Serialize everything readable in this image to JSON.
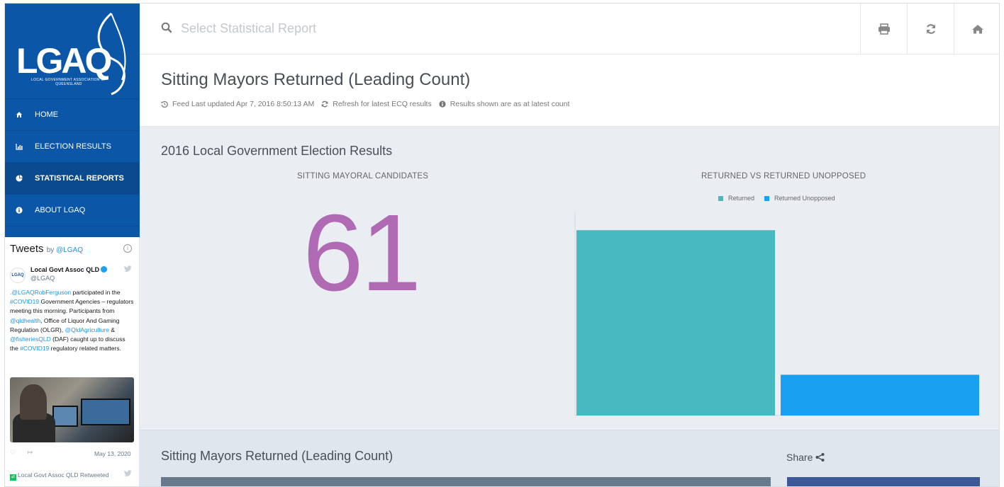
{
  "sidebar": {
    "logo": {
      "main": "LGAQ",
      "sub": "LOCAL GOVERNMENT ASSOCIATION OF QUEENSLAND"
    },
    "nav": [
      {
        "label": "HOME",
        "icon": "home-icon",
        "active": false
      },
      {
        "label": "ELECTION RESULTS",
        "icon": "bar-chart-icon",
        "active": false
      },
      {
        "label": "STATISTICAL REPORTS",
        "icon": "pie-chart-icon",
        "active": true
      },
      {
        "label": "ABOUT LGAQ",
        "icon": "info-icon",
        "active": false
      }
    ]
  },
  "tweets": {
    "heading": "Tweets",
    "by": "by",
    "handle_link": "@LGAQ",
    "tweet": {
      "avatar_text": "LGAQ",
      "name": "Local Govt Assoc QLD",
      "handle": "@LGAQ",
      "text_parts": [
        {
          "t": ".@LGAQRobFerguson",
          "link": true
        },
        {
          "t": " participated in the ",
          "link": false
        },
        {
          "t": "#COVID19",
          "link": true
        },
        {
          "t": " Government Agencies – regulators meeting this morning. Participants from ",
          "link": false
        },
        {
          "t": "@qldhealth",
          "link": true
        },
        {
          "t": ", Office of Liquor And Gaming Regulation (OLGR), ",
          "link": false
        },
        {
          "t": "@QldAgriculture",
          "link": true
        },
        {
          "t": " & ",
          "link": false
        },
        {
          "t": "@fisheriesQLD",
          "link": true
        },
        {
          "t": " (DAF) caught up to discuss the ",
          "link": false
        },
        {
          "t": "#COVID19",
          "link": true
        },
        {
          "t": " regulatory related matters.",
          "link": false
        }
      ],
      "date": "May 13, 2020"
    },
    "retweet_label": "Local Govt Assoc QLD Retweeted"
  },
  "topbar": {
    "search_placeholder": "Select Statistical Report"
  },
  "header": {
    "title": "Sitting Mayors Returned (Leading Count)",
    "meta": [
      {
        "icon": "history-icon",
        "text": "Feed Last updated Apr 7, 2016 8:50:13 AM"
      },
      {
        "icon": "refresh-small-icon",
        "text": "Refresh for latest ECQ results"
      },
      {
        "icon": "info-small-icon",
        "text": "Results shown are as at latest count"
      }
    ]
  },
  "section": {
    "title": "2016 Local Government Election Results",
    "left_label": "SITTING MAYORAL CANDIDATES",
    "big_number": "61",
    "right_label": "RETURNED VS RETURNED UNOPPOSED"
  },
  "colors": {
    "sidebar_bg": "#0b56a6",
    "big_number": "#b06ab3",
    "returned": "#48b9c0",
    "returned_unopposed": "#1aa0f0"
  },
  "chart_data": {
    "type": "bar",
    "categories": [
      "Returned",
      "Returned Unopposed"
    ],
    "series": [
      {
        "name": "Returned",
        "values": [
          50
        ]
      },
      {
        "name": "Returned Unopposed",
        "values": [
          11
        ]
      }
    ],
    "legend": [
      "Returned",
      "Returned Unopposed"
    ],
    "legend_position": "top",
    "ylim": [
      0,
      55
    ],
    "grid": false
  },
  "bottom": {
    "title": "Sitting Mayors Returned (Leading Count)",
    "share_label": "Share"
  }
}
